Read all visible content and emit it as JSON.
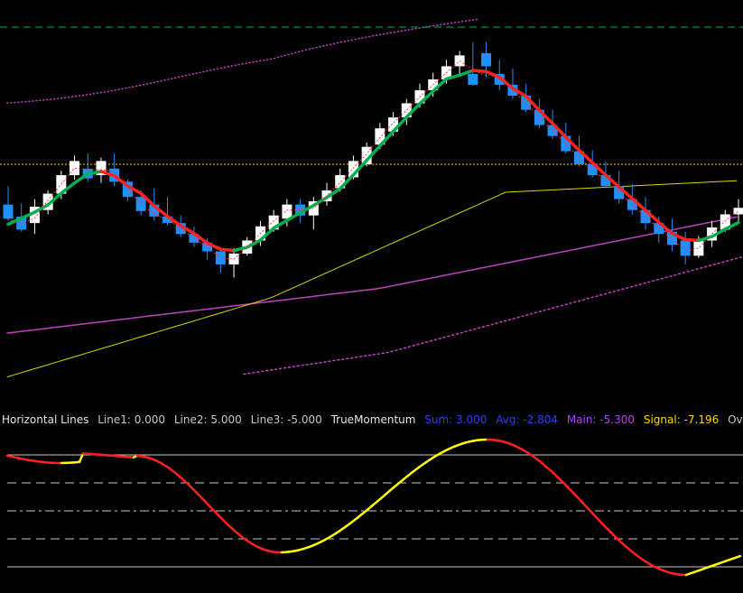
{
  "chart_data": [
    {
      "type": "candlestick",
      "panel": "main",
      "candles": [
        {
          "o": 0.35,
          "h": 0.52,
          "l": 0.2,
          "c": 0.22
        },
        {
          "o": 0.24,
          "h": 0.36,
          "l": 0.1,
          "c": 0.12
        },
        {
          "o": 0.18,
          "h": 0.4,
          "l": 0.08,
          "c": 0.33
        },
        {
          "o": 0.3,
          "h": 0.48,
          "l": 0.26,
          "c": 0.45
        },
        {
          "o": 0.45,
          "h": 0.66,
          "l": 0.4,
          "c": 0.62
        },
        {
          "o": 0.62,
          "h": 0.8,
          "l": 0.58,
          "c": 0.75
        },
        {
          "o": 0.68,
          "h": 0.82,
          "l": 0.56,
          "c": 0.59
        },
        {
          "o": 0.62,
          "h": 0.78,
          "l": 0.55,
          "c": 0.75
        },
        {
          "o": 0.68,
          "h": 0.82,
          "l": 0.52,
          "c": 0.56
        },
        {
          "o": 0.56,
          "h": 0.58,
          "l": 0.38,
          "c": 0.42
        },
        {
          "o": 0.42,
          "h": 0.48,
          "l": 0.25,
          "c": 0.29
        },
        {
          "o": 0.35,
          "h": 0.5,
          "l": 0.2,
          "c": 0.24
        },
        {
          "o": 0.24,
          "h": 0.42,
          "l": 0.16,
          "c": 0.18
        },
        {
          "o": 0.18,
          "h": 0.25,
          "l": 0.05,
          "c": 0.08
        },
        {
          "o": 0.08,
          "h": 0.15,
          "l": -0.04,
          "c": 0.0
        },
        {
          "o": 0.0,
          "h": 0.04,
          "l": -0.16,
          "c": -0.08
        },
        {
          "o": -0.08,
          "h": -0.06,
          "l": -0.28,
          "c": -0.2
        },
        {
          "o": -0.2,
          "h": -0.05,
          "l": -0.32,
          "c": -0.1
        },
        {
          "o": -0.1,
          "h": 0.05,
          "l": -0.12,
          "c": 0.02
        },
        {
          "o": 0.02,
          "h": 0.2,
          "l": -0.03,
          "c": 0.15
        },
        {
          "o": 0.12,
          "h": 0.3,
          "l": 0.1,
          "c": 0.25
        },
        {
          "o": 0.22,
          "h": 0.4,
          "l": 0.15,
          "c": 0.35
        },
        {
          "o": 0.35,
          "h": 0.4,
          "l": 0.18,
          "c": 0.25
        },
        {
          "o": 0.25,
          "h": 0.42,
          "l": 0.12,
          "c": 0.38
        },
        {
          "o": 0.38,
          "h": 0.55,
          "l": 0.34,
          "c": 0.48
        },
        {
          "o": 0.5,
          "h": 0.68,
          "l": 0.47,
          "c": 0.62
        },
        {
          "o": 0.6,
          "h": 0.8,
          "l": 0.58,
          "c": 0.75
        },
        {
          "o": 0.72,
          "h": 0.92,
          "l": 0.7,
          "c": 0.88
        },
        {
          "o": 0.9,
          "h": 1.1,
          "l": 0.86,
          "c": 1.05
        },
        {
          "o": 1.02,
          "h": 1.2,
          "l": 0.98,
          "c": 1.15
        },
        {
          "o": 1.15,
          "h": 1.32,
          "l": 1.08,
          "c": 1.28
        },
        {
          "o": 1.28,
          "h": 1.46,
          "l": 1.24,
          "c": 1.4
        },
        {
          "o": 1.4,
          "h": 1.56,
          "l": 1.34,
          "c": 1.5
        },
        {
          "o": 1.5,
          "h": 1.68,
          "l": 1.46,
          "c": 1.62
        },
        {
          "o": 1.62,
          "h": 1.76,
          "l": 1.55,
          "c": 1.72
        },
        {
          "o": 1.55,
          "h": 1.84,
          "l": 1.44,
          "c": 1.45
        },
        {
          "o": 1.74,
          "h": 1.84,
          "l": 1.52,
          "c": 1.62
        },
        {
          "o": 1.55,
          "h": 1.68,
          "l": 1.4,
          "c": 1.45
        },
        {
          "o": 1.45,
          "h": 1.6,
          "l": 1.32,
          "c": 1.35
        },
        {
          "o": 1.35,
          "h": 1.46,
          "l": 1.2,
          "c": 1.22
        },
        {
          "o": 1.22,
          "h": 1.32,
          "l": 1.05,
          "c": 1.08
        },
        {
          "o": 1.08,
          "h": 1.22,
          "l": 0.95,
          "c": 0.98
        },
        {
          "o": 0.98,
          "h": 1.1,
          "l": 0.82,
          "c": 0.84
        },
        {
          "o": 0.84,
          "h": 0.98,
          "l": 0.7,
          "c": 0.72
        },
        {
          "o": 0.72,
          "h": 0.85,
          "l": 0.6,
          "c": 0.62
        },
        {
          "o": 0.62,
          "h": 0.75,
          "l": 0.5,
          "c": 0.52
        },
        {
          "o": 0.52,
          "h": 0.66,
          "l": 0.36,
          "c": 0.4
        },
        {
          "o": 0.4,
          "h": 0.54,
          "l": 0.26,
          "c": 0.3
        },
        {
          "o": 0.3,
          "h": 0.42,
          "l": 0.12,
          "c": 0.18
        },
        {
          "o": 0.18,
          "h": 0.24,
          "l": 0.0,
          "c": 0.08
        },
        {
          "o": 0.1,
          "h": 0.22,
          "l": -0.08,
          "c": -0.02
        },
        {
          "o": 0.02,
          "h": 0.1,
          "l": -0.2,
          "c": -0.12
        },
        {
          "o": -0.12,
          "h": 0.06,
          "l": -0.14,
          "c": 0.02
        },
        {
          "o": 0.02,
          "h": 0.2,
          "l": -0.04,
          "c": 0.14
        },
        {
          "o": 0.12,
          "h": 0.3,
          "l": 0.1,
          "c": 0.26
        },
        {
          "o": 0.26,
          "h": 0.4,
          "l": 0.2,
          "c": 0.32
        }
      ],
      "colors": {
        "bull": "#ffffff",
        "bear": "#1e90ff",
        "grid_level": "#ffd700",
        "top_level": "#00b050"
      },
      "ma_bull_color": "#00b050",
      "ma_bear_color": "#ff2020",
      "ma_dotted_color": "#ff3030",
      "level_yellow": 0.72,
      "level_top": 1.98
    },
    {
      "type": "line",
      "panel": "oscillator",
      "colors": {
        "up": "#ffff00",
        "down": "#ff2020",
        "levels": "#c8c8c8"
      },
      "levels": [
        5.0,
        2.5,
        0.0,
        -2.5,
        -5.0
      ]
    }
  ],
  "indicator_label": {
    "name": "Horizontal Lines",
    "line1": "Line1: 0.000",
    "line2": "Line2: 5.000",
    "line3": "Line3: -5.000",
    "title": "TrueMomentum",
    "sum": "Sum: 3.000",
    "avg": "Avg: -2.804",
    "main": "Main: -5.300",
    "signal": "Signal: -7.196",
    "overflow": "Overb"
  },
  "label_colors": {
    "name": "#e6e6e6",
    "title": "#e6e6e6",
    "lines": "#c8c8c8",
    "sum": "#2a40ff",
    "avg": "#2a40ff",
    "main": "#b040ff",
    "signal": "#ffd700",
    "overflow": "#c8c8c8"
  }
}
